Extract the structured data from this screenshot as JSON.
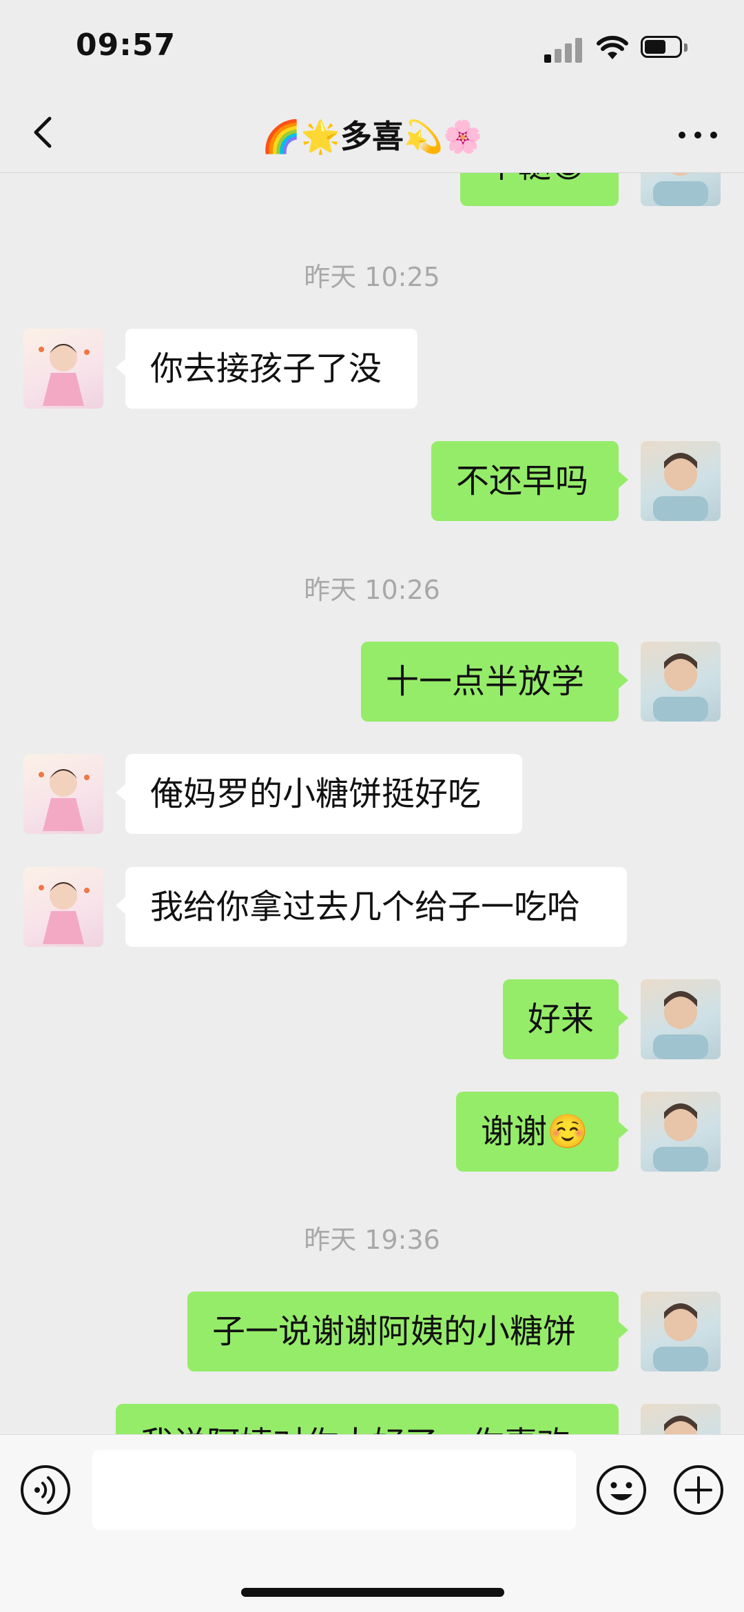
{
  "status_bar": {
    "time": "09:57"
  },
  "header": {
    "title": "🌈🌟多喜💫🌸",
    "back_icon": "chevron-left-icon",
    "more_icon": "more-dots-icon"
  },
  "messages": {
    "partial_top_text": "个鞑😁",
    "ts1": "昨天 10:25",
    "m1": "你去接孩子了没",
    "m2": "不还早吗",
    "ts2": "昨天 10:26",
    "m3": "十一点半放学",
    "m4": "俺妈罗的小糖饼挺好吃",
    "m5": "我给你拿过去几个给子一吃哈",
    "m6": "好来",
    "m7": "谢谢☺️",
    "ts3": "昨天 19:36",
    "m8": "子一说谢谢阿姨的小糖饼",
    "m9_partial": "我说阿姨对你太好了，你喜欢"
  },
  "input_bar": {
    "voice_icon": "voice-icon",
    "emoji_icon": "emoji-icon",
    "plus_icon": "plus-icon"
  },
  "colors": {
    "self_bubble": "#95ec69",
    "other_bubble": "#ffffff",
    "background": "#ededed"
  }
}
